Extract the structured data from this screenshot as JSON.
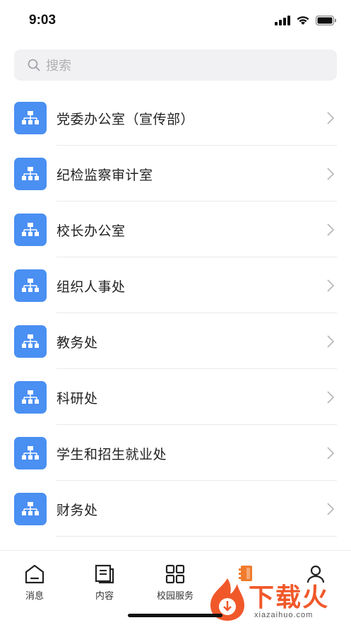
{
  "status_bar": {
    "time": "9:03"
  },
  "search": {
    "placeholder": "搜索"
  },
  "list": [
    {
      "label": "党委办公室（宣传部）"
    },
    {
      "label": "纪检监察审计室"
    },
    {
      "label": "校长办公室"
    },
    {
      "label": "组织人事处"
    },
    {
      "label": "教务处"
    },
    {
      "label": "科研处"
    },
    {
      "label": "学生和招生就业处"
    },
    {
      "label": "财务处"
    }
  ],
  "tabbar": {
    "tabs": [
      {
        "label": "消息",
        "icon": "home-icon"
      },
      {
        "label": "内容",
        "icon": "document-icon"
      },
      {
        "label": "校园服务",
        "icon": "grid-icon"
      },
      {
        "label": "",
        "icon": "contacts-icon",
        "active": true
      },
      {
        "label": "",
        "icon": "person-icon"
      }
    ]
  },
  "watermark": {
    "text": "下载火",
    "sub": "xiazaihuo.com"
  },
  "colors": {
    "accent": "#4a8ff2",
    "active_tab": "#f07b2c",
    "watermark": "#f0582a"
  }
}
